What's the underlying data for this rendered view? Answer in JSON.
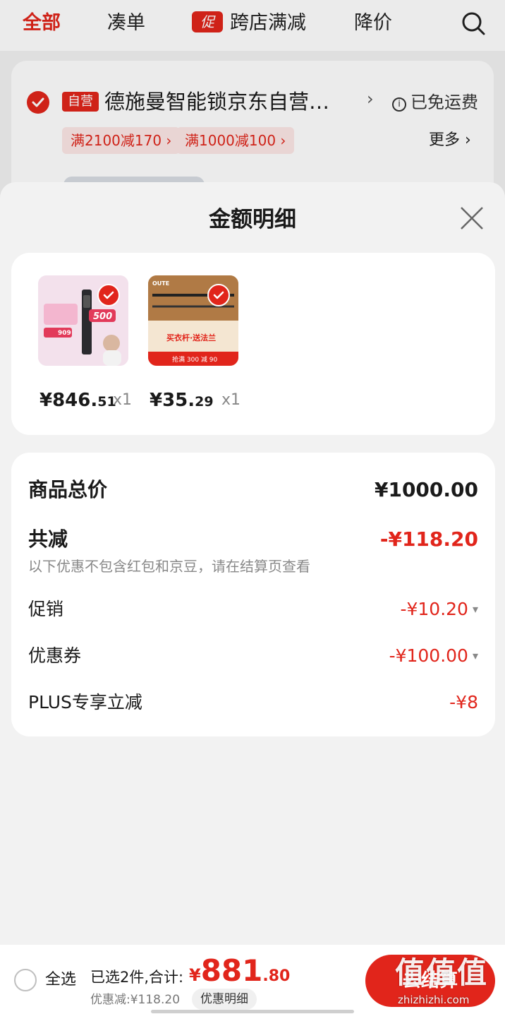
{
  "topbar": {
    "tabs": [
      {
        "label": "全部"
      },
      {
        "label": "凑单"
      },
      {
        "label": "跨店满减",
        "badge": "促"
      },
      {
        "label": "降价"
      }
    ]
  },
  "shop": {
    "self_badge": "自营",
    "name": "德施曼智能锁京东自营…",
    "shipping": "已免运费",
    "coupons": [
      "满2100减170 ›",
      "满1000减100 ›"
    ],
    "more": "更多 ›"
  },
  "sheet": {
    "title": "金额明细",
    "products": [
      {
        "price_main": "¥846.",
        "price_cents": "51",
        "qty": "x1",
        "image_text": {
          "badge": "500",
          "price": "909"
        }
      },
      {
        "price_main": "¥35.",
        "price_cents": "29",
        "qty": "x1",
        "image_text": {
          "headline": "买衣杆·送法兰",
          "bottom": "抢满 300 减 90",
          "brand": "OUTE"
        }
      }
    ],
    "summary": {
      "subtotal_label": "商品总价",
      "subtotal_value": "¥1000.00",
      "total_discount_label": "共减",
      "total_discount_value": "-¥118.20",
      "note": "以下优惠不包含红包和京豆，请在结算页查看",
      "rows": [
        {
          "label": "促销",
          "value": "-¥10.20",
          "expandable": true
        },
        {
          "label": "优惠券",
          "value": "-¥100.00",
          "expandable": true
        },
        {
          "label": "PLUS专享立减",
          "value": "-¥8",
          "expandable": false
        }
      ]
    }
  },
  "footer": {
    "select_all": "全选",
    "selected_text": "已选2件,合计:",
    "total_currency": "¥",
    "total_int": "881",
    "total_dec": ".80",
    "discount_text": "优惠减:¥118.20",
    "detail_button": "优惠明细",
    "checkout_label": "去结算"
  },
  "watermark": {
    "main": "值值值",
    "site": "zhizhizhi.com"
  },
  "colors": {
    "accent": "#e1251b",
    "background": "#f2f2f2",
    "card": "#ffffff",
    "muted": "#888888"
  }
}
